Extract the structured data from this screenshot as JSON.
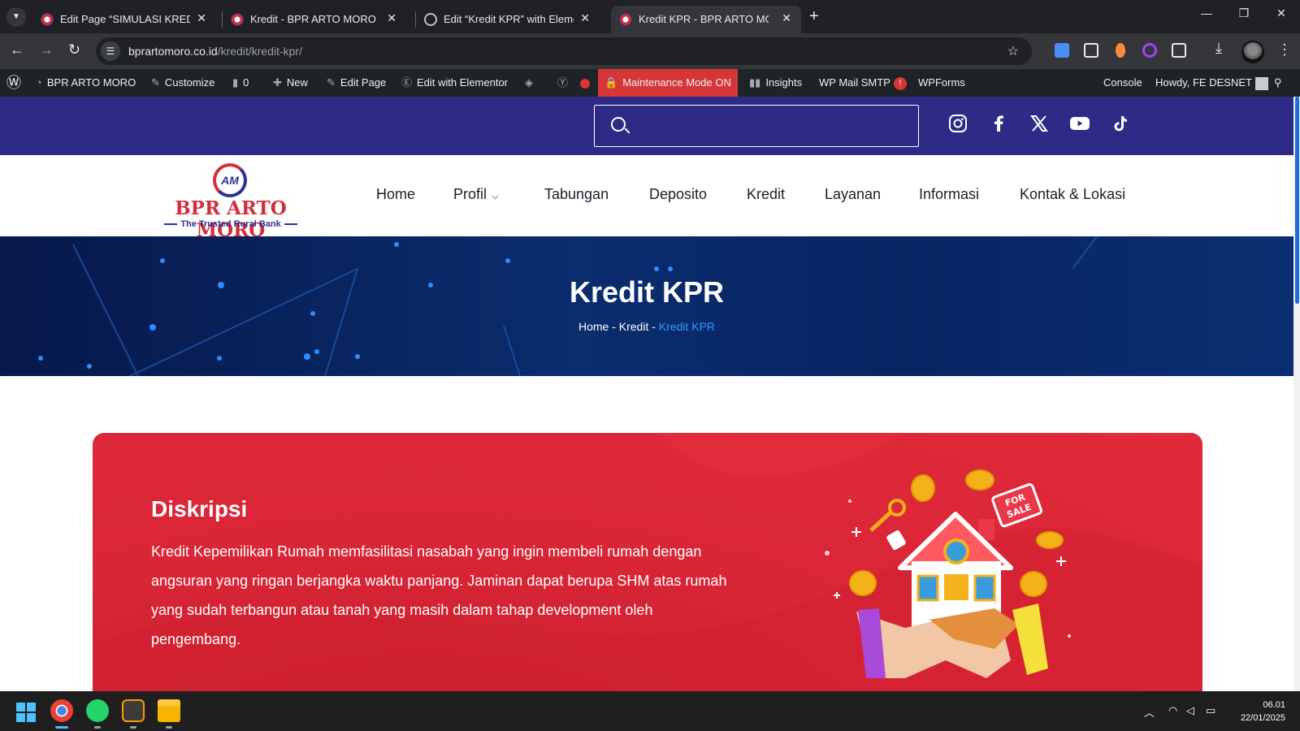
{
  "browser": {
    "tabs": [
      {
        "title": "Edit Page “SIMULASI KREDIT BPR",
        "favicon": "wp-logo",
        "active": false
      },
      {
        "title": "Kredit - BPR ARTO MORO",
        "favicon": "wp-logo",
        "active": false
      },
      {
        "title": "Edit “Kredit KPR” with Elementor",
        "favicon": "globe-icon",
        "active": false
      },
      {
        "title": "Kredit KPR - BPR ARTO MORO",
        "favicon": "wp-logo",
        "active": true
      }
    ],
    "url_host": "bprartomoro.co.id",
    "url_path": "/kredit/kredit-kpr/"
  },
  "admin_bar": {
    "site_name": "BPR ARTO MORO",
    "customize": "Customize",
    "comments_count": "0",
    "new": "New",
    "edit_page": "Edit Page",
    "edit_elementor": "Edit with Elementor",
    "maintenance": "Maintenance Mode ON",
    "insights": "Insights",
    "wp_mail": "WP Mail SMTP",
    "wp_mail_badge": "!",
    "wpforms": "WPForms",
    "console": "Console",
    "howdy": "Howdy, FE DESNET"
  },
  "site": {
    "search_placeholder": "",
    "social": [
      "instagram-icon",
      "facebook-icon",
      "x-icon",
      "youtube-icon",
      "tiktok-icon"
    ],
    "logo": {
      "name": "BPR ARTO MORO",
      "tagline": "The Trusted Rural Bank",
      "mark": "AM"
    },
    "nav": [
      "Home",
      "Profil",
      "Tabungan",
      "Deposito",
      "Kredit",
      "Layanan",
      "Informasi",
      "Kontak & Lokasi"
    ]
  },
  "hero": {
    "title": "Kredit KPR",
    "breadcrumb": [
      "Home",
      "Kredit",
      "Kredit KPR"
    ],
    "separator": "-"
  },
  "content": {
    "heading": "Diskripsi",
    "body": "Kredit Kepemilikan Rumah memfasilitasi nasabah yang ingin membeli rumah dengan angsuran yang ringan berjangka waktu panjang. Jaminan dapat berupa SHM atas rumah yang sudah terbangun atau tanah yang masih dalam tahap development oleh pengembang.",
    "illustration_sign": "FOR SALE"
  },
  "taskbar": {
    "time": "06.01",
    "date": "22/01/2025"
  },
  "colors": {
    "site_topbar": "#2e2b86",
    "card_red": "#d92636",
    "brand_red": "#d32e3a",
    "brand_blue": "#2e3192",
    "breadcrumb_current": "#2f9bff"
  }
}
